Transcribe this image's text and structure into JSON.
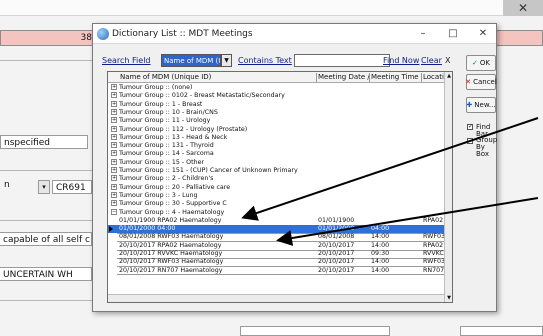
{
  "background": {
    "field_number": "38",
    "unspecified_value": "nspecified",
    "n_value": "n",
    "cr_value": "CR691",
    "capable_text": "capable of all self c",
    "uncertain_text": "UNCERTAIN WH"
  },
  "dialog": {
    "title": "Dictionary List :: MDT Meetings",
    "close_glyph": "✕",
    "search_field_label": "Search Field",
    "search_field_value": "Name of MDM (Unique ID)",
    "contains_text_label": "Contains Text",
    "contains_text_value": "",
    "find_now_label": "Find Now",
    "clear_label": "Clear",
    "clear_x": "X",
    "columns": [
      "Name of MDM (Unique ID)",
      "Meeting Date /",
      "Meeting Time",
      "Locatio"
    ],
    "groups": [
      {
        "name": "Tumour Group :: (none)"
      },
      {
        "name": "Tumour Group :: 0102 - Breast Metastatic/Secondary"
      },
      {
        "name": "Tumour Group :: 1 - Breast"
      },
      {
        "name": "Tumour Group :: 10 - Brain/CNS"
      },
      {
        "name": "Tumour Group :: 11 - Urology"
      },
      {
        "name": "Tumour Group :: 112 - Urology (Prostate)"
      },
      {
        "name": "Tumour Group :: 13 - Head & Neck"
      },
      {
        "name": "Tumour Group :: 131 - Thyroid"
      },
      {
        "name": "Tumour Group :: 14 - Sarcoma"
      },
      {
        "name": "Tumour Group :: 15 - Other"
      },
      {
        "name": "Tumour Group :: 151 - (CUP) Cancer of Unknown Primary"
      },
      {
        "name": "Tumour Group :: 2 - Children's"
      },
      {
        "name": "Tumour Group :: 20 - Palliative care"
      },
      {
        "name": "Tumour Group :: 3 - Lung"
      },
      {
        "name": "Tumour Group :: 30 - Supportive C"
      },
      {
        "name": "Tumour Group :: 4 - Haematology"
      }
    ],
    "meetings": [
      {
        "name": "01/01/1900 RPA02 Haematology",
        "date": "01/01/1900",
        "time": "",
        "loc": "RPA02"
      },
      {
        "name": "01/01/2000 04:00",
        "date": "01/01/2000",
        "time": "04:00",
        "loc": ""
      },
      {
        "name": "08/01/2008 RWF03 Haematology",
        "date": "08/01/2008",
        "time": "14:00",
        "loc": "RWF03"
      },
      {
        "name": "20/10/2017 RPA02 Haematology",
        "date": "20/10/2017",
        "time": "14:00",
        "loc": "RPA02"
      },
      {
        "name": "20/10/2017 RVVKC Haematology",
        "date": "20/10/2017",
        "time": "09:30",
        "loc": "RVVKC"
      },
      {
        "name": "20/10/2017 RWF03 Haematology",
        "date": "20/10/2017",
        "time": "14:00",
        "loc": "RWF03"
      },
      {
        "name": "20/10/2017 RN707 Haematology",
        "date": "20/10/2017",
        "time": "14:00",
        "loc": "RN707"
      }
    ],
    "ok_label": "OK",
    "cancel_label": "Cancel",
    "new_label": "New...",
    "find_bar_label": "Find Bar",
    "group_by_box_label": "Group By Box",
    "find_bar_checked": true,
    "group_by_box_checked": false
  }
}
